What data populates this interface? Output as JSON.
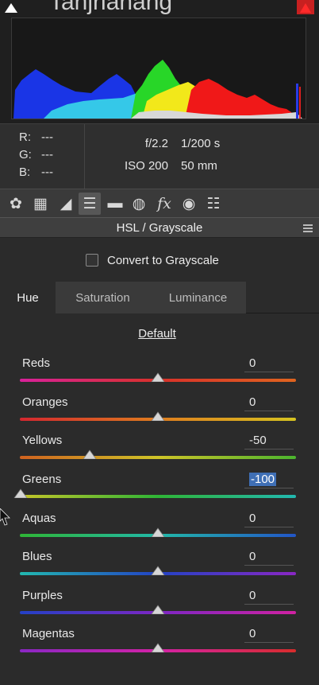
{
  "histogram": {
    "overlay_text": "Tanjrianang",
    "channels": [
      "red",
      "green",
      "blue",
      "yellow",
      "cyan"
    ]
  },
  "info": {
    "rgb": [
      {
        "label": "R:",
        "value": "---"
      },
      {
        "label": "G:",
        "value": "---"
      },
      {
        "label": "B:",
        "value": "---"
      }
    ],
    "aperture": "f/2.2",
    "shutter": "1/200 s",
    "iso": "ISO 200",
    "focal_length": "50 mm"
  },
  "toolbar": {
    "tools": [
      {
        "name": "aperture-icon",
        "glyph": "✿"
      },
      {
        "name": "grid-icon",
        "glyph": "▦"
      },
      {
        "name": "tone-curve-icon",
        "glyph": "◢"
      },
      {
        "name": "hsl-icon",
        "glyph": "☰",
        "active": true
      },
      {
        "name": "split-toning-icon",
        "glyph": "▬"
      },
      {
        "name": "lens-icon",
        "glyph": "◍"
      },
      {
        "name": "fx-icon",
        "glyph": "fx"
      },
      {
        "name": "camera-icon",
        "glyph": "◉"
      },
      {
        "name": "presets-icon",
        "glyph": "☷"
      }
    ]
  },
  "panel": {
    "title": "HSL / Grayscale",
    "convert_label": "Convert to Grayscale",
    "convert_checked": false,
    "tabs": [
      {
        "label": "Hue",
        "active": true
      },
      {
        "label": "Saturation",
        "active": false
      },
      {
        "label": "Luminance",
        "active": false
      }
    ],
    "default_label": "Default"
  },
  "sliders": [
    {
      "label": "Reds",
      "value": "0",
      "level": 0,
      "colors": [
        "#d8219a",
        "#d8312a",
        "#e0641f"
      ]
    },
    {
      "label": "Oranges",
      "value": "0",
      "level": 0,
      "colors": [
        "#d3272f",
        "#df7d1e",
        "#d6c321"
      ]
    },
    {
      "label": "Yellows",
      "value": "-50",
      "level": -50,
      "colors": [
        "#d0621f",
        "#cfc428",
        "#4bb52e"
      ]
    },
    {
      "label": "Greens",
      "value": "-100",
      "level": -100,
      "selected": true,
      "colors": [
        "#c6c529",
        "#2fb536",
        "#22b8b0"
      ]
    },
    {
      "label": "Aquas",
      "value": "0",
      "level": 0,
      "colors": [
        "#2fb536",
        "#22b9a8",
        "#2256c8"
      ]
    },
    {
      "label": "Blues",
      "value": "0",
      "level": 0,
      "colors": [
        "#22b8b0",
        "#2343c5",
        "#8a27c4"
      ]
    },
    {
      "label": "Purples",
      "value": "0",
      "level": 0,
      "colors": [
        "#2441c6",
        "#7c27c4",
        "#d022a2"
      ]
    },
    {
      "label": "Magentas",
      "value": "0",
      "level": 0,
      "colors": [
        "#8a27c4",
        "#d322a6",
        "#d82c2c"
      ]
    }
  ],
  "colors": {
    "accent_selection": "#3f6fb5",
    "panel_bg": "#2b2b2b"
  }
}
